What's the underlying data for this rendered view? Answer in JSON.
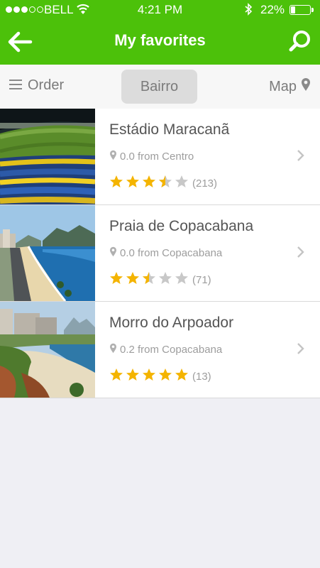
{
  "status": {
    "carrier": "BELL",
    "time": "4:21 PM",
    "battery": "22%",
    "battery_level": 0.22
  },
  "nav": {
    "title": "My favorites"
  },
  "filters": {
    "order": "Order",
    "bairro": "Bairro",
    "map": "Map"
  },
  "places": [
    {
      "name": "Estádio Maracanã",
      "location": "0.0 from Centro",
      "rating": 3.5,
      "reviews": "(213)"
    },
    {
      "name": "Praia de Copacabana",
      "location": "0.0 from Copacabana",
      "rating": 2.5,
      "reviews": "(71)"
    },
    {
      "name": "Morro do Arpoador",
      "location": "0.2 from Copacabana",
      "rating": 5,
      "reviews": "(13)"
    }
  ],
  "colors": {
    "brand": "#4cc10a",
    "star": "#f4b400",
    "star_empty": "#c8c8c8"
  }
}
